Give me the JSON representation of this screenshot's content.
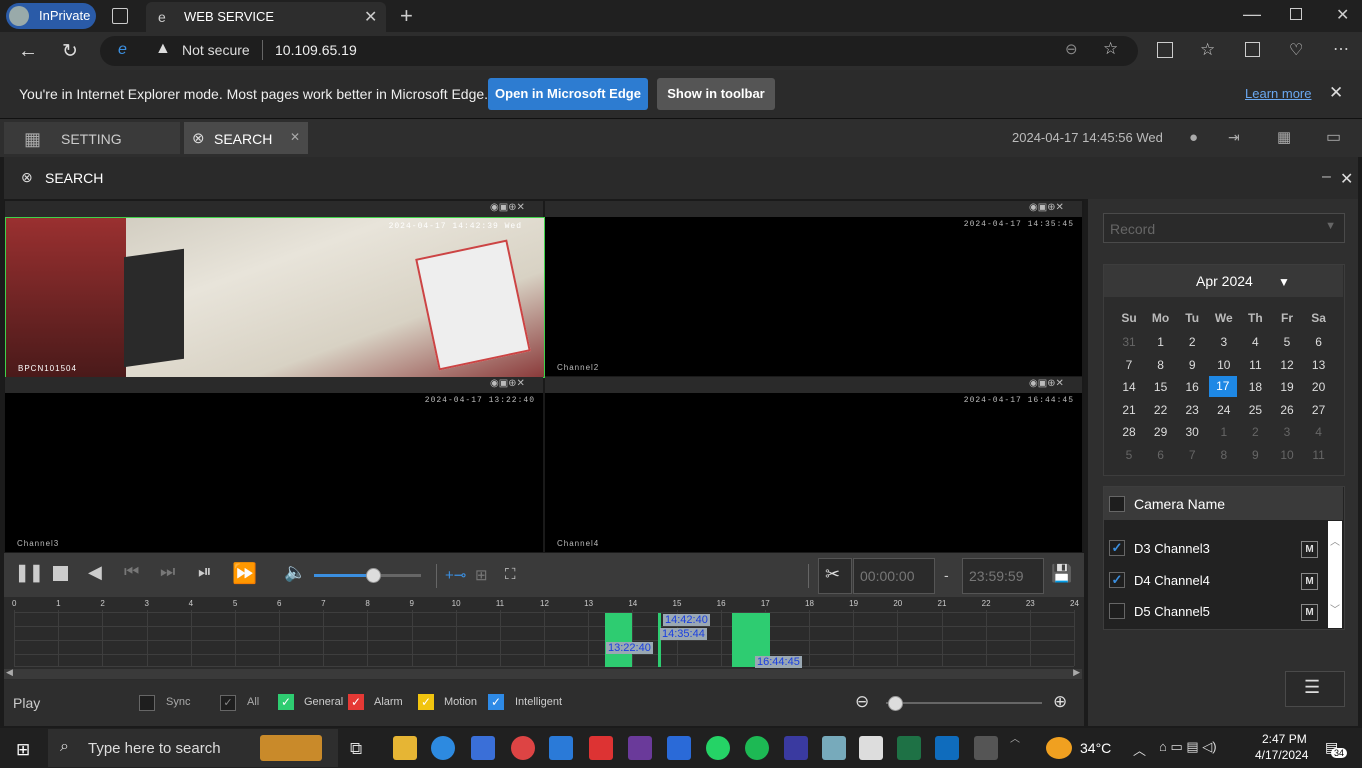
{
  "browser": {
    "inprivate_label": "InPrivate",
    "tab_title": "WEB SERVICE",
    "not_secure": "Not secure",
    "url": "10.109.65.19"
  },
  "ie_bar": {
    "message": "You're in Internet Explorer mode. Most pages work better in Microsoft Edge.",
    "open_edge": "Open in Microsoft Edge",
    "show_toolbar": "Show in toolbar",
    "learn_more": "Learn more"
  },
  "app": {
    "tab_setting": "SETTING",
    "tab_search": "SEARCH",
    "datetime": "2024-04-17 14:45:56 Wed",
    "panel_title": "SEARCH"
  },
  "video": {
    "cells": [
      {
        "time": "2024-04-17 14:42:39 Wed",
        "name": "BPCN101504"
      },
      {
        "time": "2024-04-17 14:35:45",
        "name": "Channel2"
      },
      {
        "time": "2024-04-17 13:22:40",
        "name": "Channel3"
      },
      {
        "time": "2024-04-17 16:44:45",
        "name": "Channel4"
      }
    ]
  },
  "controls": {
    "clip_start": "00:00:00",
    "clip_sep": "-",
    "clip_end": "23:59:59",
    "volume_level": 0.55
  },
  "timeline": {
    "hours": [
      "0",
      "1",
      "2",
      "3",
      "4",
      "5",
      "6",
      "7",
      "8",
      "9",
      "10",
      "11",
      "12",
      "13",
      "14",
      "15",
      "16",
      "17",
      "18",
      "19",
      "20",
      "21",
      "22",
      "23",
      "24"
    ],
    "labels": [
      "14:42:40",
      "14:35:44",
      "13:22:40",
      "16:44:45"
    ]
  },
  "legend": {
    "play": "Play",
    "sync": "Sync",
    "all": "All",
    "general": "General",
    "alarm": "Alarm",
    "motion": "Motion",
    "intelligent": "Intelligent",
    "colors": {
      "general": "#2ecc71",
      "alarm": "#e53935",
      "motion": "#f1c40f",
      "intelligent": "#2e8ae6"
    }
  },
  "right": {
    "record_placeholder": "Record",
    "calendar_month": "Apr 2024",
    "weekdays": [
      "Su",
      "Mo",
      "Tu",
      "We",
      "Th",
      "Fr",
      "Sa"
    ],
    "days": [
      [
        "31",
        "1",
        "2",
        "3",
        "4",
        "5",
        "6"
      ],
      [
        "7",
        "8",
        "9",
        "10",
        "11",
        "12",
        "13"
      ],
      [
        "14",
        "15",
        "16",
        "17",
        "18",
        "19",
        "20"
      ],
      [
        "21",
        "22",
        "23",
        "24",
        "25",
        "26",
        "27"
      ],
      [
        "28",
        "29",
        "30",
        "1",
        "2",
        "3",
        "4"
      ],
      [
        "5",
        "6",
        "7",
        "8",
        "9",
        "10",
        "11"
      ]
    ],
    "selected_day": "17",
    "camera_header": "Camera Name",
    "cameras": [
      {
        "name": "D3 Channel3",
        "checked": true,
        "mode": "M"
      },
      {
        "name": "D4 Channel4",
        "checked": true,
        "mode": "M"
      },
      {
        "name": "D5 Channel5",
        "checked": false,
        "mode": "M"
      }
    ]
  },
  "taskbar": {
    "search_placeholder": "Type here to search",
    "weather": "34°C",
    "time": "2:47 PM",
    "date": "4/17/2024",
    "notifications": "34"
  }
}
